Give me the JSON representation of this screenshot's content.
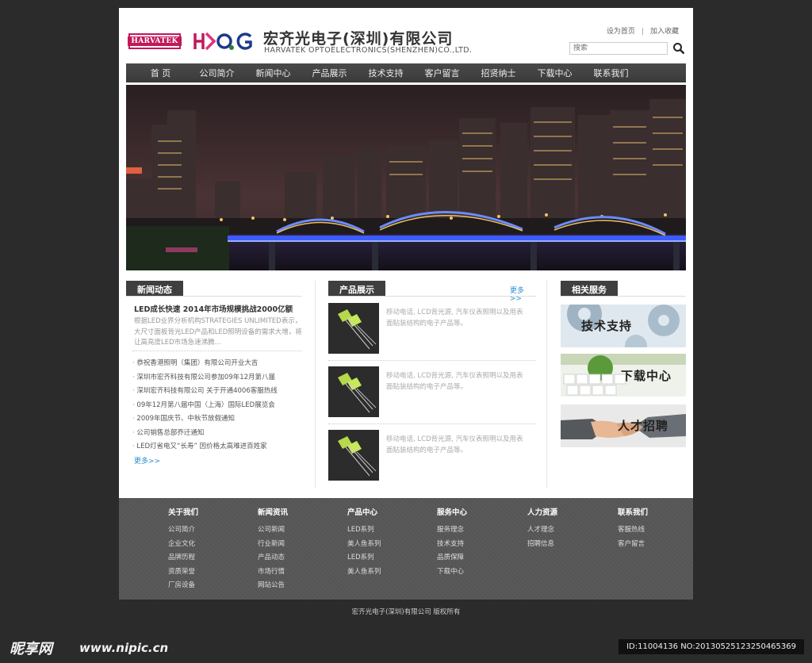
{
  "header": {
    "logo_text": "HARVATEK",
    "company_cn": "宏齐光电子(深圳)有限公司",
    "company_en": "HARVATEK OPTOELECTRONICS(SHENZHEN)CO.,LTD.",
    "link_home": "设为首页",
    "link_sep": "|",
    "link_fav": "加入收藏",
    "search_placeholder": "搜索"
  },
  "nav": [
    "首 页",
    "公司简介",
    "新闻中心",
    "产品展示",
    "技术支持",
    "客户留言",
    "招贤纳士",
    "下载中心",
    "联系我们"
  ],
  "news": {
    "title": "新闻动态",
    "headline": "LED成长快速 2014年市场规模挑战2000亿额",
    "summary": "根据LED业界分析机构STRATEGIES UNLIMITED表示，大尺寸面板背光LED产品和LED照明设备的需求大增，将让高亮度LED市场急速沸腾…",
    "items": [
      "恭祝香港照明（集团）有限公司开业大吉",
      "深圳市宏齐科技有限公司参加09年12月第八届",
      "深圳宏齐科技有限公司 关于开通4006客服热线",
      "09年12月第八届中国（上海）国际LED展览会",
      "2009年国庆节、中秋节放假通知",
      "公司销售总部乔迁通知",
      "LED灯省电又“长寿” 因价格太高难进百姓家"
    ],
    "more": "更多>>"
  },
  "products": {
    "title": "产品展示",
    "more": "更多>>",
    "items": [
      {
        "desc": "移动电话, LCD背光源, 汽车仪表照明以及用表面贴装结构的电子产品等。"
      },
      {
        "desc": "移动电话, LCD背光源, 汽车仪表照明以及用表面贴装结构的电子产品等。"
      },
      {
        "desc": "移动电话, LCD背光源, 汽车仪表照明以及用表面贴装结构的电子产品等。"
      }
    ]
  },
  "services": {
    "title": "相关服务",
    "items": [
      "技术支持",
      "下载中心",
      "人才招聘"
    ]
  },
  "footer": {
    "columns": [
      {
        "title": "关于我们",
        "links": [
          "公司简介",
          "企业文化",
          "品牌历程",
          "资质荣誉",
          "厂房设备"
        ]
      },
      {
        "title": "新闻资讯",
        "links": [
          "公司新闻",
          "行业新闻",
          "产品动态",
          "市场行情",
          "网站公告"
        ]
      },
      {
        "title": "产品中心",
        "links": [
          "LED系列",
          "美人鱼系列",
          "LED系列",
          "美人鱼系列"
        ]
      },
      {
        "title": "服务中心",
        "links": [
          "服务理念",
          "技术支持",
          "品质保障",
          "下载中心"
        ]
      },
      {
        "title": "人力资源",
        "links": [
          "人才理念",
          "招聘信息"
        ]
      },
      {
        "title": "联系我们",
        "links": [
          "客服热线",
          "客户留言"
        ]
      }
    ],
    "copyright": "宏齐光电子(深圳)有限公司    版权所有"
  },
  "watermark": {
    "brand": "昵享网",
    "url": "www.nipic.cn",
    "id": "ID:11004136 NO:20130525123250465369"
  },
  "colors": {
    "nav_bg": "#3f3f3f",
    "accent_link": "#2a8fcf",
    "logo_magenta": "#c2185b",
    "page_bg": "#2b2b2b"
  }
}
